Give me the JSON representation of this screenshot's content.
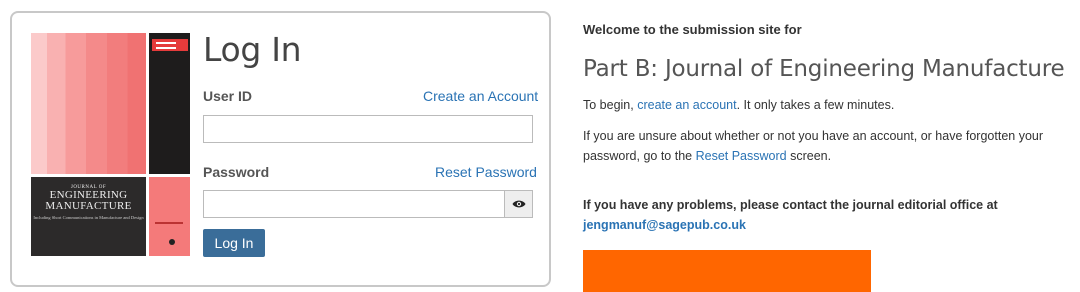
{
  "login": {
    "title": "Log In",
    "user_id_label": "User ID",
    "create_account_link": "Create an Account",
    "user_id_value": "",
    "password_label": "Password",
    "reset_password_link": "Reset Password",
    "password_value": "",
    "login_button": "Log In"
  },
  "cover": {
    "line1": "JOURNAL OF",
    "line2": "ENGINEERING",
    "line3": "MANUFACTURE",
    "subtitle": "Including Short Communications in Manufacture and Design"
  },
  "info": {
    "welcome": "Welcome to the submission site for",
    "journal_title": "Part B: Journal of Engineering Manufacture",
    "begin_prefix": "To begin,",
    "begin_link": "create an account",
    "begin_suffix": ". It only takes a few minutes.",
    "unsure_prefix": "If you are unsure about whether or not you have an account, or have forgotten your password, go to the",
    "unsure_link": "Reset Password",
    "unsure_suffix": "screen.",
    "problems_text": "If you have any problems, please contact the journal editorial office at",
    "contact_email": "jengmanuf@sagepub.co.uk"
  },
  "colors": {
    "link": "#2a73b4",
    "button": "#3a6d99",
    "banner": "#ff6600"
  },
  "icons": {
    "password_toggle": "eye-icon"
  }
}
